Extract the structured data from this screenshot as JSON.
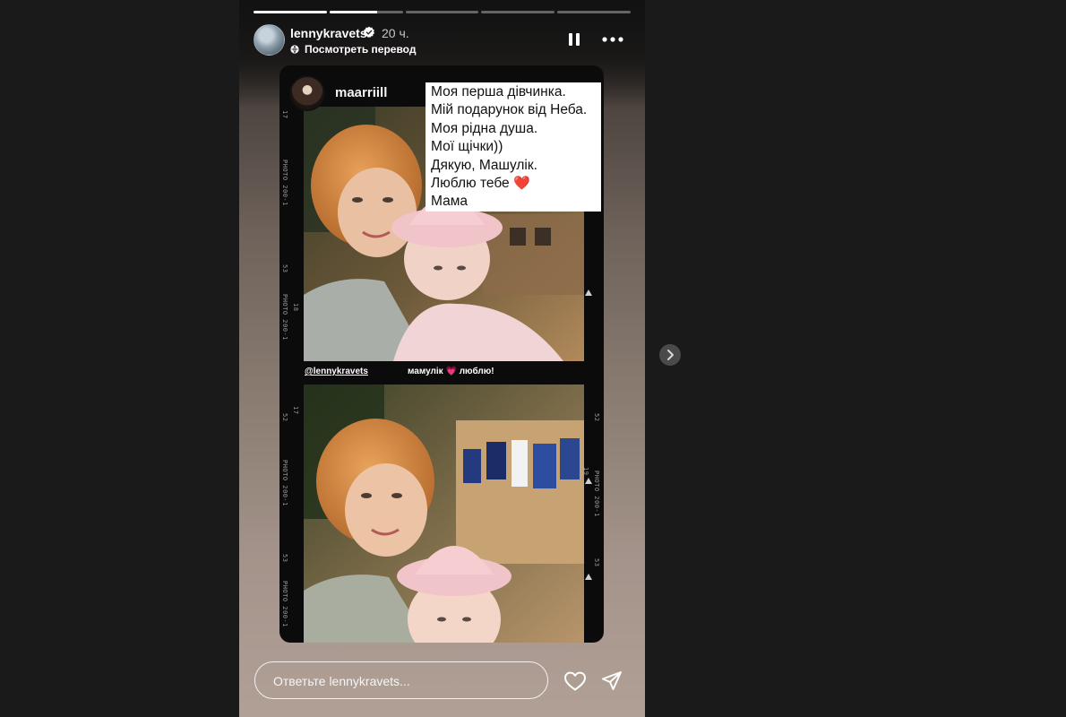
{
  "story": {
    "author": "lennykravets",
    "posted_ago": "20 ч.",
    "translate_label": "Посмотреть перевод",
    "progress": [
      1,
      0.65,
      0,
      0,
      0
    ]
  },
  "sticker": {
    "username": "maarriill",
    "note_lines": [
      "Моя перша дівчинка.",
      "Мій подарунок від Неба.",
      "Моя рідна душа.",
      "Мої щічки))",
      "Дякую, Машулік.",
      "Люблю тебе",
      "Мама"
    ],
    "heart_emoji": "❤️"
  },
  "film": {
    "frame_text": "PHOTO 200-1",
    "numbers": [
      "17",
      "18",
      "19",
      "52",
      "53"
    ]
  },
  "overlay": {
    "mention": "@lennykravets",
    "caption_start": "мамулік",
    "caption_heart": "💗",
    "caption_end": "люблю!"
  },
  "reply": {
    "placeholder": "Ответьте lennykravets..."
  },
  "colors": {
    "background": "#1a1a1a",
    "card": "#0b0b0b",
    "verified": "#ffffff",
    "heart": "#d81a2a"
  },
  "icons": [
    "verified-icon",
    "globe-icon",
    "pause-icon",
    "more-icon",
    "like-icon",
    "share-icon",
    "chevron-right-icon"
  ]
}
